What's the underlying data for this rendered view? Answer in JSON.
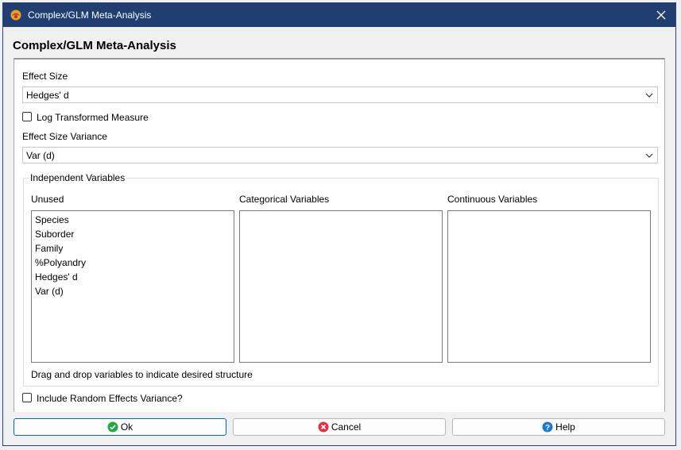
{
  "window": {
    "title": "Complex/GLM Meta-Analysis"
  },
  "dialog": {
    "heading": "Complex/GLM Meta-Analysis"
  },
  "effect_size": {
    "label": "Effect Size",
    "selected": "Hedges' d"
  },
  "log_transformed": {
    "label": "Log Transformed Measure",
    "checked": false
  },
  "variance": {
    "label": "Effect Size Variance",
    "selected": "Var (d)"
  },
  "independent": {
    "legend": "Independent Variables",
    "unused_label": "Unused",
    "categorical_label": "Categorical Variables",
    "continuous_label": "Continuous Variables",
    "unused_items": [
      "Species",
      "Suborder",
      "Family",
      "%Polyandry",
      "Hedges' d",
      "Var (d)"
    ],
    "hint": "Drag and drop variables to indicate desired structure"
  },
  "random_effects": {
    "label": "Include Random Effects Variance?",
    "checked": false
  },
  "buttons": {
    "ok": "Ok",
    "cancel": "Cancel",
    "help": "Help"
  },
  "colors": {
    "titlebar": "#213e73",
    "ok_icon": "#22a845",
    "cancel_icon": "#e0333e",
    "help_icon": "#1c79d4"
  }
}
